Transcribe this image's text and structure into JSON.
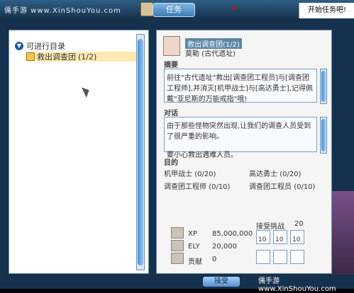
{
  "header": {
    "watermark": "儒手游 www.XinShouYou.com",
    "window_title": "任务",
    "start_button": "开始任务吧!",
    "close_symbol": "×"
  },
  "quest_list": {
    "root_label": "可进行目录",
    "items": [
      {
        "label": "救出调查团",
        "progress": "(1/2)"
      }
    ]
  },
  "quest_detail": {
    "quest_title": "救出调查团",
    "quest_progress": "(1/2)",
    "npc_name": "莫勒 (古代遗址)",
    "summary_label": "摘要",
    "summary_text": "前往\"古代遗址\"救出[调查团工程员]与[调查团工程师],并消灭[机甲战士]与[高达勇士],记得佩戴\"亚尼斯的万能戒指\"哦!",
    "dialog_label": "对话",
    "dialog_text": "由于那些怪物突然出现,让我们的调查人员受到了很严重的影响。\n\n要小心救出遇难人员。",
    "targets_label": "目的",
    "targets": [
      {
        "name": "机甲战士",
        "count": "(0/20)"
      },
      {
        "name": "高达勇士",
        "count": "(0/20)"
      },
      {
        "name": "调查团工程师",
        "count": "(0/10)"
      },
      {
        "name": "调查团工程员",
        "count": "(0/10)"
      }
    ],
    "rewards": {
      "xp_label": "XP",
      "xp_value": "85,000,000",
      "ely_label": "ELY",
      "ely_value": "20,000",
      "contrib_label": "贡献",
      "contrib_value": "0",
      "challenge_label": "接受挑战",
      "challenge_value": "20",
      "item_counts": [
        "10",
        "10",
        "10"
      ]
    }
  },
  "footer": {
    "accept_button": "接受",
    "watermark": "儒手游 www.XinShouYou.com"
  }
}
